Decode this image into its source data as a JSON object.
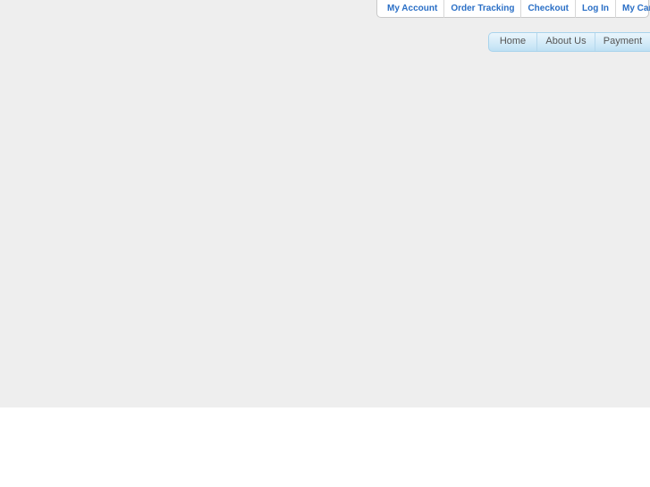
{
  "account_bar": {
    "items": [
      {
        "label": "My Account"
      },
      {
        "label": "Order Tracking"
      },
      {
        "label": "Checkout"
      },
      {
        "label": "Log In"
      },
      {
        "label": "My Cart"
      }
    ]
  },
  "main_nav": {
    "items": [
      {
        "label": "Home"
      },
      {
        "label": "About Us"
      },
      {
        "label": "Payment"
      }
    ]
  },
  "colors": {
    "link_blue": "#2a6fc6",
    "nav_text": "#555555",
    "nav_gradient_top": "#eaf5fc",
    "nav_gradient_bottom": "#bfe0f4",
    "page_background": "#eeeeee"
  }
}
